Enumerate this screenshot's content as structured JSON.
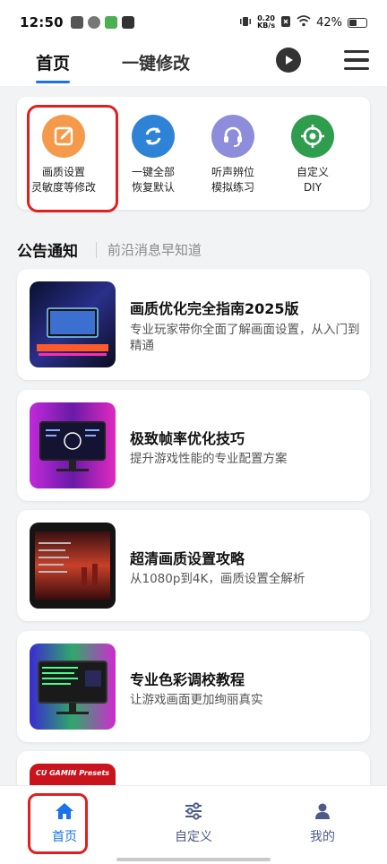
{
  "status_bar": {
    "time": "12:50",
    "net_speed_value": "0.20",
    "net_speed_unit": "KB/s",
    "battery_pct": "42%"
  },
  "header": {
    "tabs": [
      {
        "label": "首页",
        "active": true
      },
      {
        "label": "一键修改",
        "active": false
      }
    ],
    "accent_color": "#1a73e8"
  },
  "quick_actions": [
    {
      "line1": "画质设置",
      "line2": "灵敏度等修改",
      "icon": "edit-icon",
      "color": "#f59a4a"
    },
    {
      "line1": "一键全部",
      "line2": "恢复默认",
      "icon": "refresh-icon",
      "color": "#2f83d6"
    },
    {
      "line1": "听声辨位",
      "line2": "模拟练习",
      "icon": "headset-icon",
      "color": "#8e8ddc"
    },
    {
      "line1": "自定义",
      "line2": "DIY",
      "icon": "crosshair-icon",
      "color": "#2e9e4e"
    }
  ],
  "notice": {
    "title": "公告通知",
    "subtitle": "前沿消息早知道"
  },
  "articles": [
    {
      "title": "画质优化完全指南2025版",
      "desc": "专业玩家带你全面了解画面设置，从入门到精通"
    },
    {
      "title": "极致帧率优化技巧",
      "desc": "提升游戏性能的专业配置方案"
    },
    {
      "title": "超清画质设置攻略",
      "desc": "从1080p到4K，画质设置全解析"
    },
    {
      "title": "专业色彩调校教程",
      "desc": "让游戏画面更加绚丽真实"
    },
    {
      "thumb_text": "CU GAMIN Presets"
    }
  ],
  "bottom_nav": [
    {
      "label": "首页",
      "icon": "home-icon",
      "active": true
    },
    {
      "label": "自定义",
      "icon": "sliders-icon",
      "active": false
    },
    {
      "label": "我的",
      "icon": "person-icon",
      "active": false
    }
  ]
}
